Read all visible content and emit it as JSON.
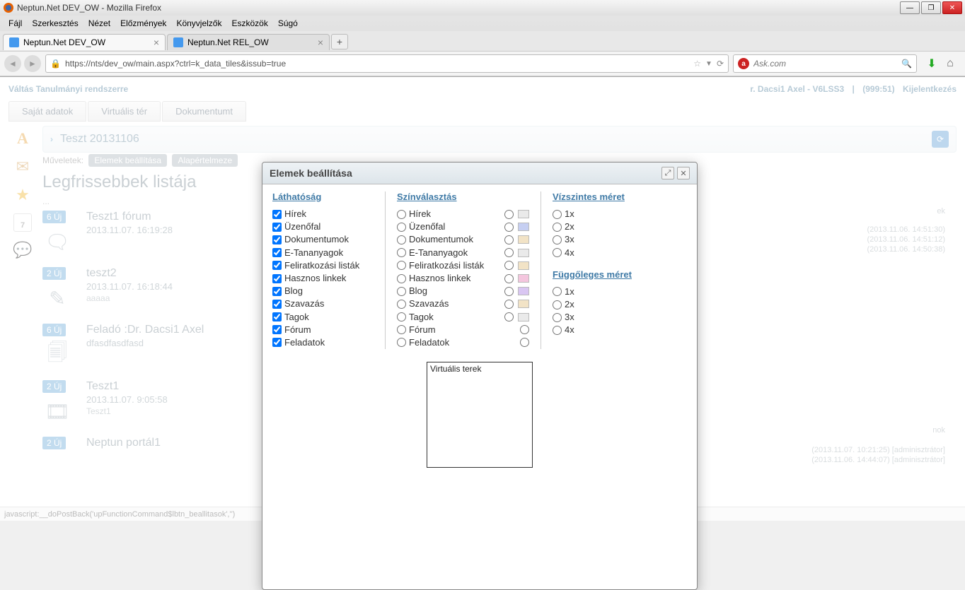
{
  "window": {
    "title": "Neptun.Net DEV_OW - Mozilla Firefox"
  },
  "menubar": [
    "Fájl",
    "Szerkesztés",
    "Nézet",
    "Előzmények",
    "Könyvjelzők",
    "Eszközök",
    "Súgó"
  ],
  "tabs": [
    {
      "label": "Neptun.Net DEV_OW",
      "active": true
    },
    {
      "label": "Neptun.Net REL_OW",
      "active": false
    }
  ],
  "url": "https://nts/dev_ow/main.aspx?ctrl=k_data_tiles&issub=true",
  "search_placeholder": "Ask.com",
  "top_links": {
    "left": "Váltás Tanulmányi rendszerre",
    "user": "r. Dacsi1 Axel - V6LSS3",
    "code": "(999:51)",
    "logout": "Kijelentkezés"
  },
  "main_nav": [
    "Saját adatok",
    "Virtuális tér",
    "Dokumentumt"
  ],
  "sidebar_cal": "7",
  "breadcrumb": "Teszt 20131106",
  "ops": {
    "label": "Műveletek:",
    "btn1": "Elemek beállítása",
    "btn2": "Alapértelmeze"
  },
  "list_title": "Legfrissebbek listája",
  "dots": "...",
  "feed": [
    {
      "badge": "6 Új",
      "title": "Teszt1 fórum",
      "meta": "2013.11.07. 16:19:28",
      "extra": "",
      "icon": "chat"
    },
    {
      "badge": "2 Új",
      "title": "teszt2",
      "meta": "2013.11.07. 16:18:44",
      "extra": "aaaaa",
      "icon": "pencil"
    },
    {
      "badge": "6 Új",
      "title": "Feladó :Dr. Dacsi1 Axel",
      "meta": "dfasdfasdfasd",
      "extra": "",
      "icon": "copy"
    },
    {
      "badge": "2 Új",
      "title": "Teszt1",
      "meta": "2013.11.07. 9:05:58",
      "extra": "Teszt1",
      "icon": "video"
    },
    {
      "badge": "2 Új",
      "title": "Neptun portál1",
      "meta": "",
      "extra": "",
      "icon": ""
    }
  ],
  "right_feed_visible": {
    "ek": "ek",
    "times": [
      "(2013.11.06. 14:51:30)",
      "(2013.11.06. 14:51:12)",
      "(2013.11.06. 14:50:38)"
    ],
    "nok": "nok",
    "lines2": [
      "(2013.11.07. 10:21:25) [adminisztrátor]",
      "(2013.11.06. 14:44:07) [adminisztrátor]"
    ]
  },
  "modal": {
    "title": "Elemek beállítása",
    "col1_title": "Láthatóság",
    "col2_title": "Színválasztás",
    "col3_title1": "Vízszintes méret",
    "col3_title2": "Függőleges méret",
    "visibility": [
      {
        "label": "Hírek",
        "checked": true
      },
      {
        "label": "Üzenőfal",
        "checked": true
      },
      {
        "label": "Dokumentumok",
        "checked": true
      },
      {
        "label": "E-Tananyagok",
        "checked": true
      },
      {
        "label": "Feliratkozási listák",
        "checked": true
      },
      {
        "label": "Hasznos linkek",
        "checked": true
      },
      {
        "label": "Blog",
        "checked": true
      },
      {
        "label": "Szavazás",
        "checked": true
      },
      {
        "label": "Tagok",
        "checked": true
      },
      {
        "label": "Fórum",
        "checked": true
      },
      {
        "label": "Feladatok",
        "checked": true
      }
    ],
    "colors": [
      {
        "label": "Hírek",
        "swatch": "#eaeaea"
      },
      {
        "label": "Üzenőfal",
        "swatch": "#c6cff2"
      },
      {
        "label": "Dokumentumok",
        "swatch": "#f2e3c6"
      },
      {
        "label": "E-Tananyagok",
        "swatch": "#eaeaea"
      },
      {
        "label": "Feliratkozási listák",
        "swatch": "#f2e3c6"
      },
      {
        "label": "Hasznos linkek",
        "swatch": "#f4c6de"
      },
      {
        "label": "Blog",
        "swatch": "#d9c6f2"
      },
      {
        "label": "Szavazás",
        "swatch": "#f2e3c6"
      },
      {
        "label": "Tagok",
        "swatch": "#eaeaea"
      },
      {
        "label": "Fórum",
        "swatch": ""
      },
      {
        "label": "Feladatok",
        "swatch": ""
      }
    ],
    "hsizes": [
      "1x",
      "2x",
      "3x",
      "4x"
    ],
    "vsizes": [
      "1x",
      "2x",
      "3x",
      "4x"
    ],
    "vt_box": "Virtuális terek"
  },
  "statusbar": "javascript:__doPostBack('upFunctionCommand$lbtn_beallitasok','')"
}
